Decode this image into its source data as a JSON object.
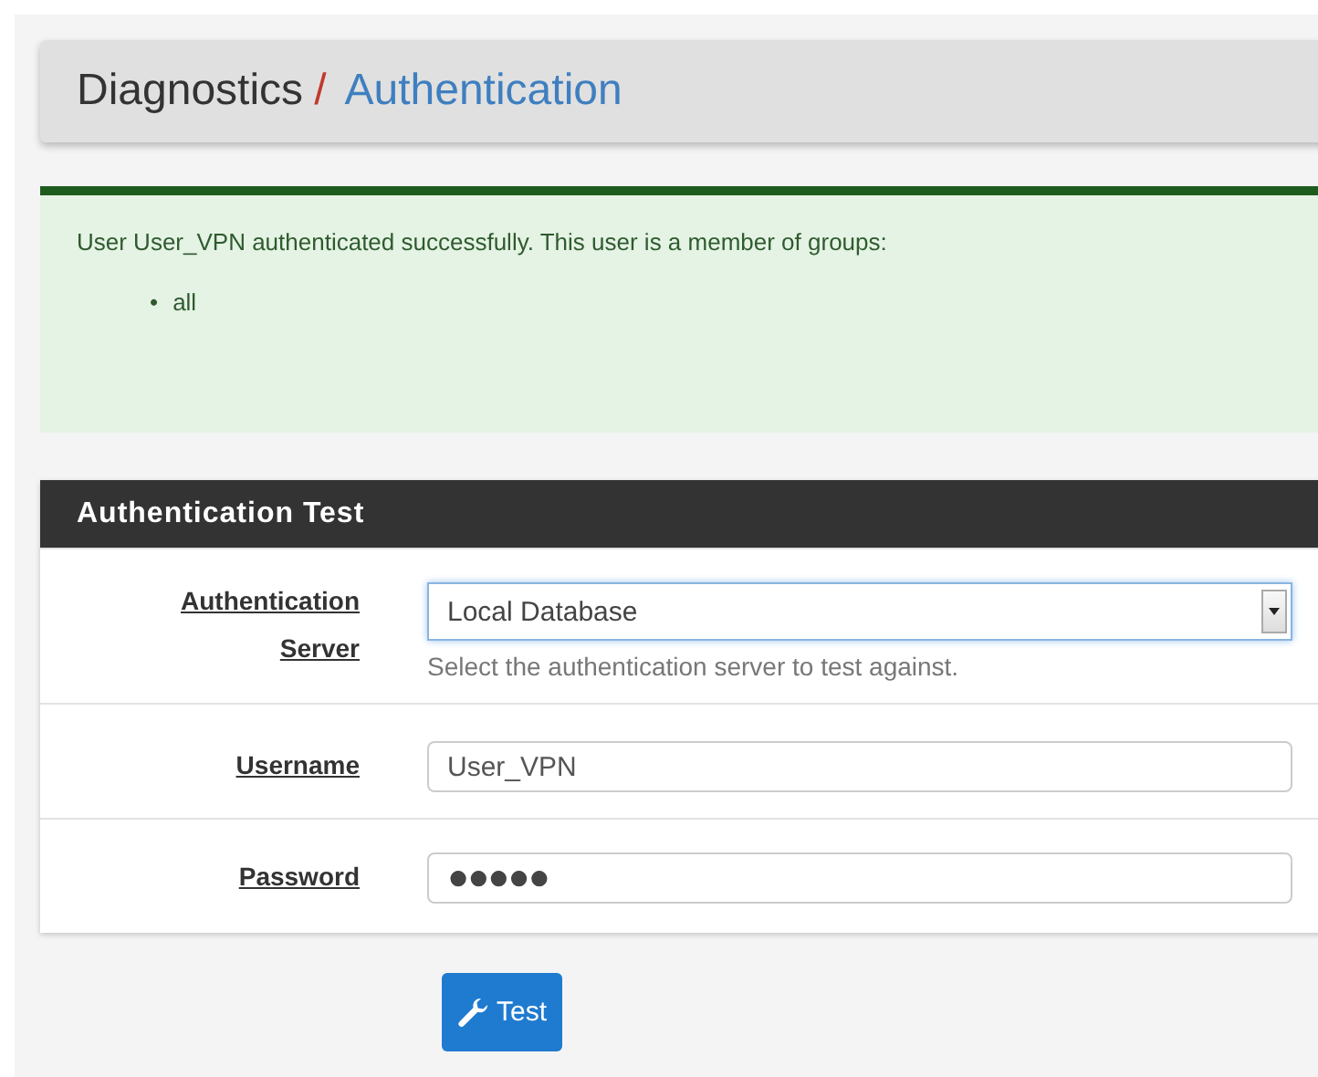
{
  "breadcrumb": {
    "section": "Diagnostics",
    "separator": "/",
    "page": "Authentication"
  },
  "alert": {
    "message": "User User_VPN authenticated successfully. This user is a member of groups:",
    "groups": [
      {
        "bullet": "•",
        "name": "all"
      }
    ]
  },
  "panel": {
    "title": "Authentication Test",
    "fields": [
      {
        "kind": "select",
        "label": "Authentication Server",
        "value": "Local Database",
        "help": "Select the authentication server to test against."
      },
      {
        "kind": "text",
        "label": "Username",
        "value": "User_VPN"
      },
      {
        "kind": "password",
        "label": "Password",
        "value": "●●●●●"
      }
    ]
  },
  "button": {
    "label": "Test"
  }
}
